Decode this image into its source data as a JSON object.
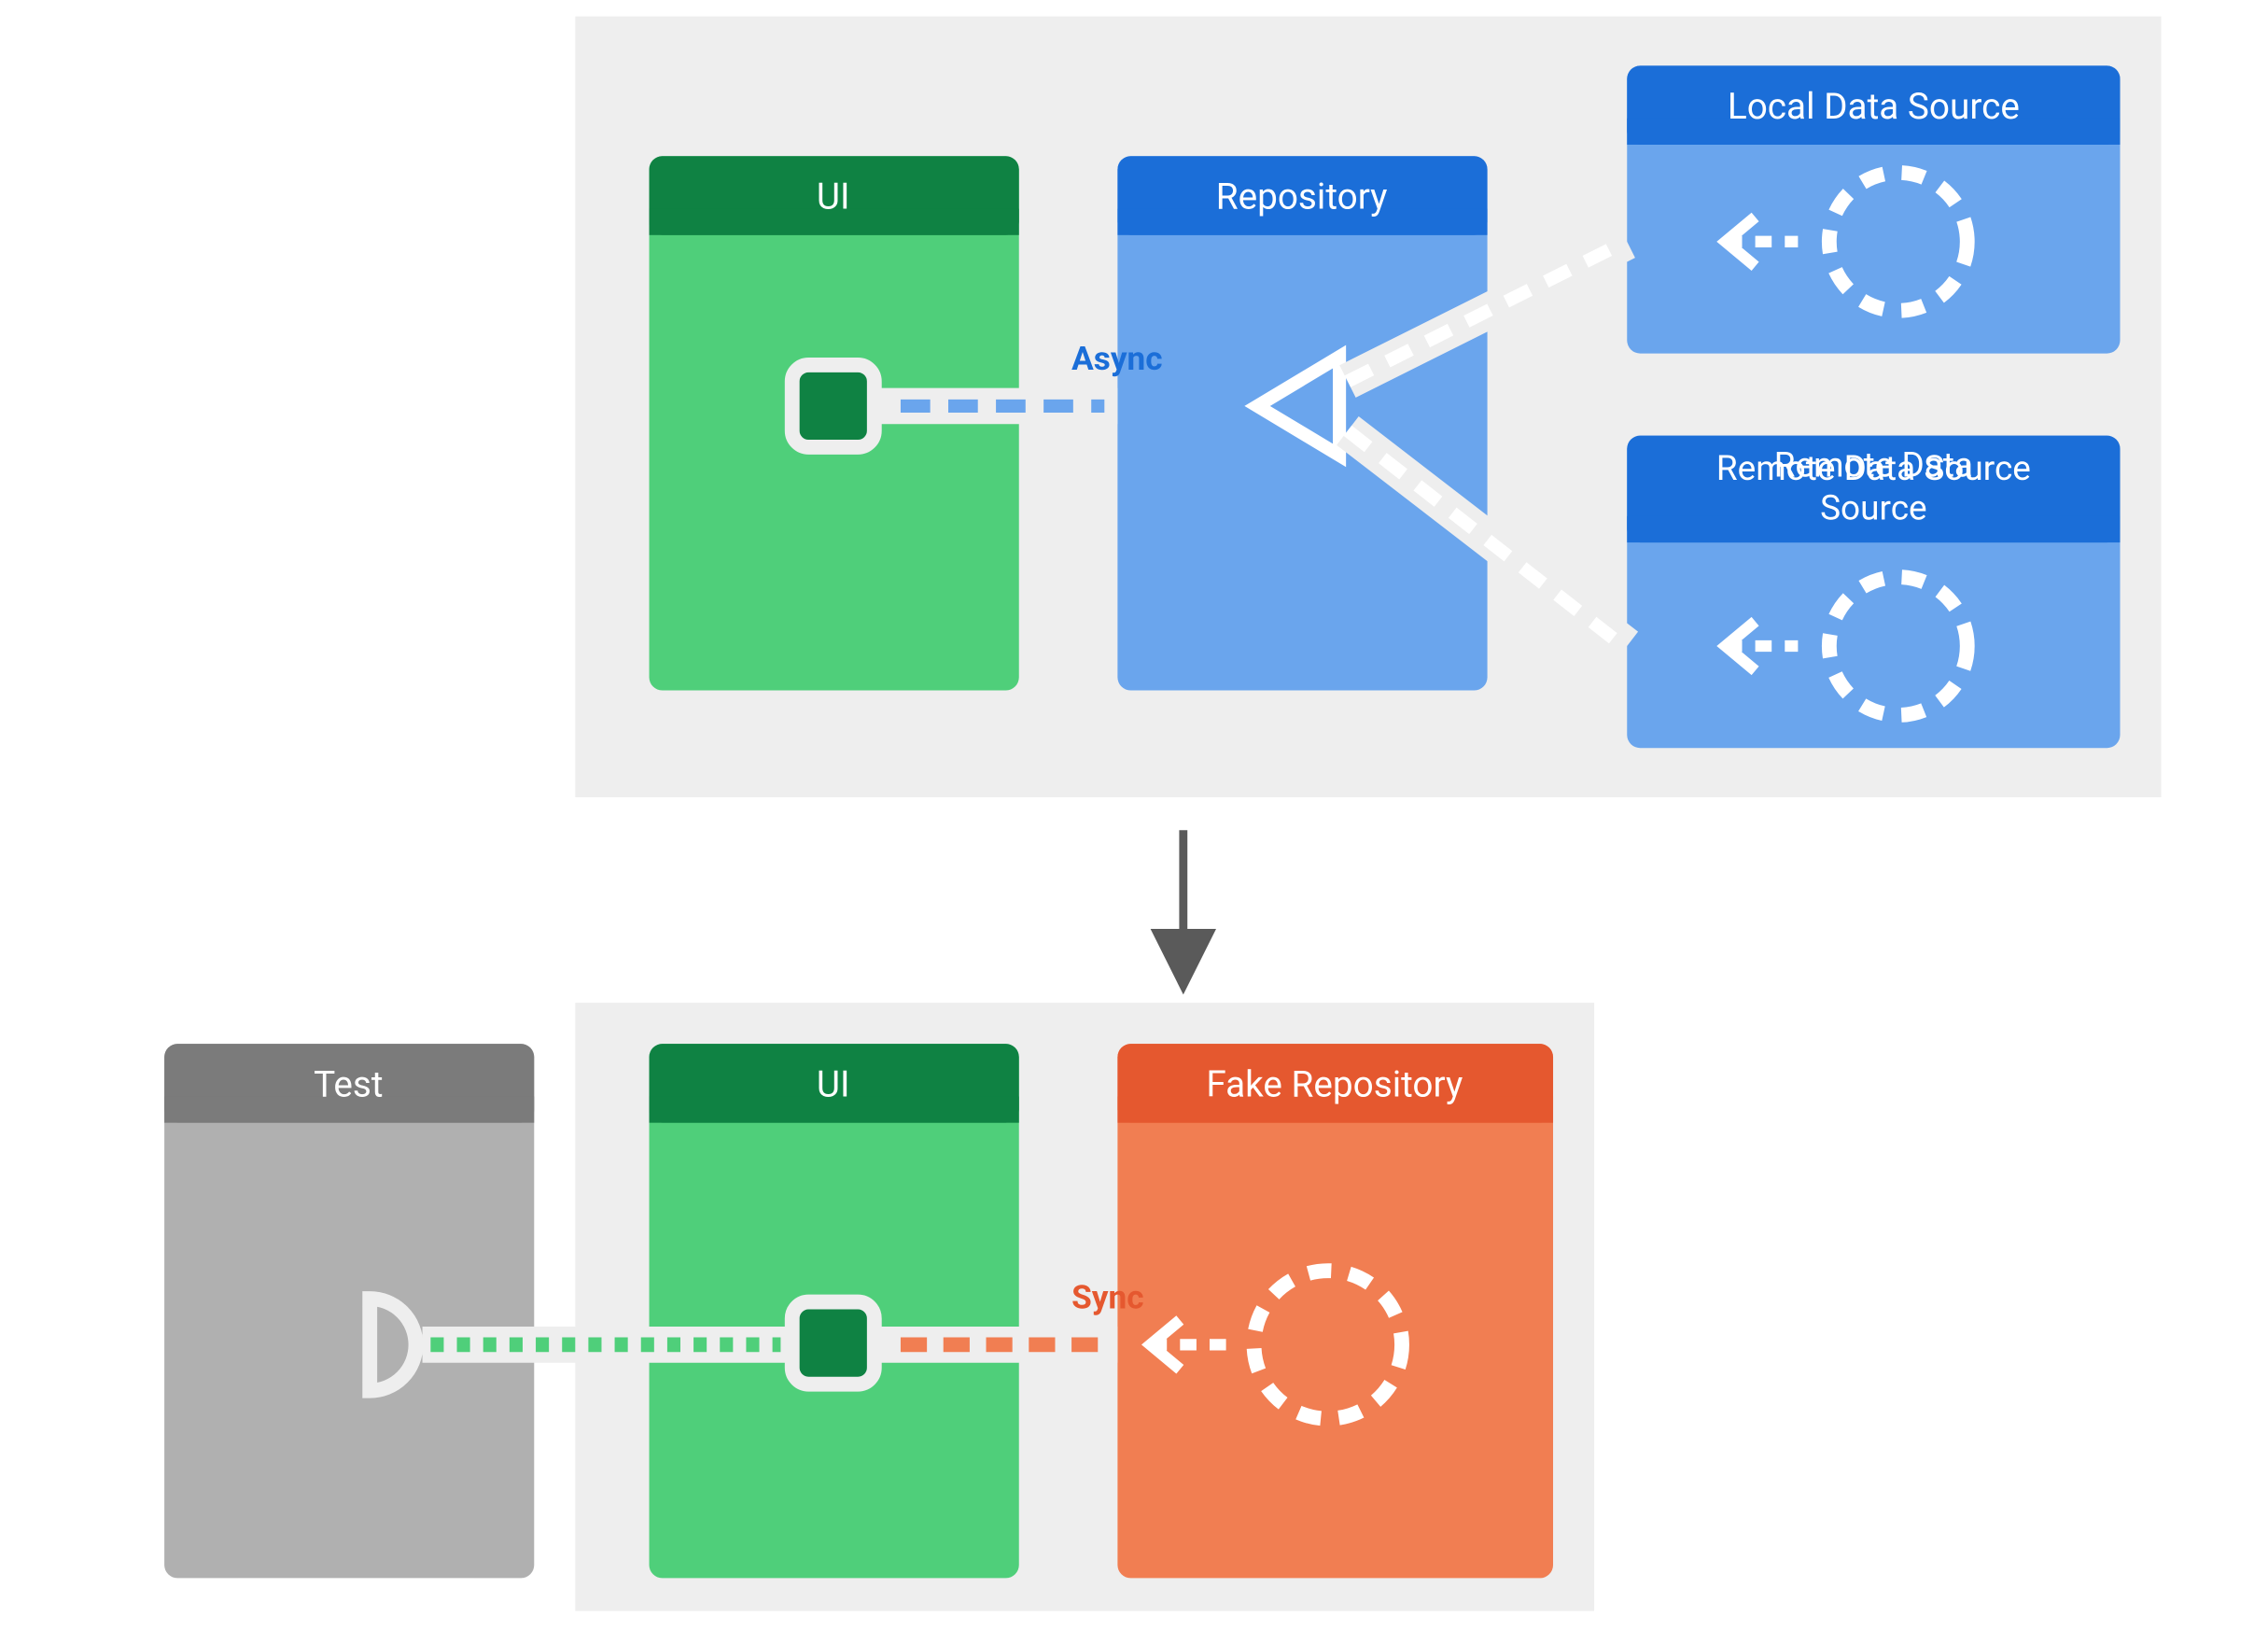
{
  "colors": {
    "panel": "#eeeeee",
    "greenHeader": "#0f8243",
    "greenBody": "#4fcf7a",
    "blueHeader": "#1b6ed8",
    "blueBody": "#6aa5ed",
    "orangeHeader": "#e5582f",
    "orangeBody": "#f17e52",
    "grayHeader": "#7b7b7b",
    "grayBody": "#b0b0b0",
    "white": "#ffffff",
    "arrowGray": "#5a5a5a"
  },
  "top": {
    "ui": "UI",
    "repo": "Repository",
    "local": "Local Data Source",
    "remote": "Remote Data Source",
    "async": "Async"
  },
  "bottom": {
    "test": "Test",
    "ui": "UI",
    "fake": "Fake Repository",
    "sync": "Sync"
  }
}
